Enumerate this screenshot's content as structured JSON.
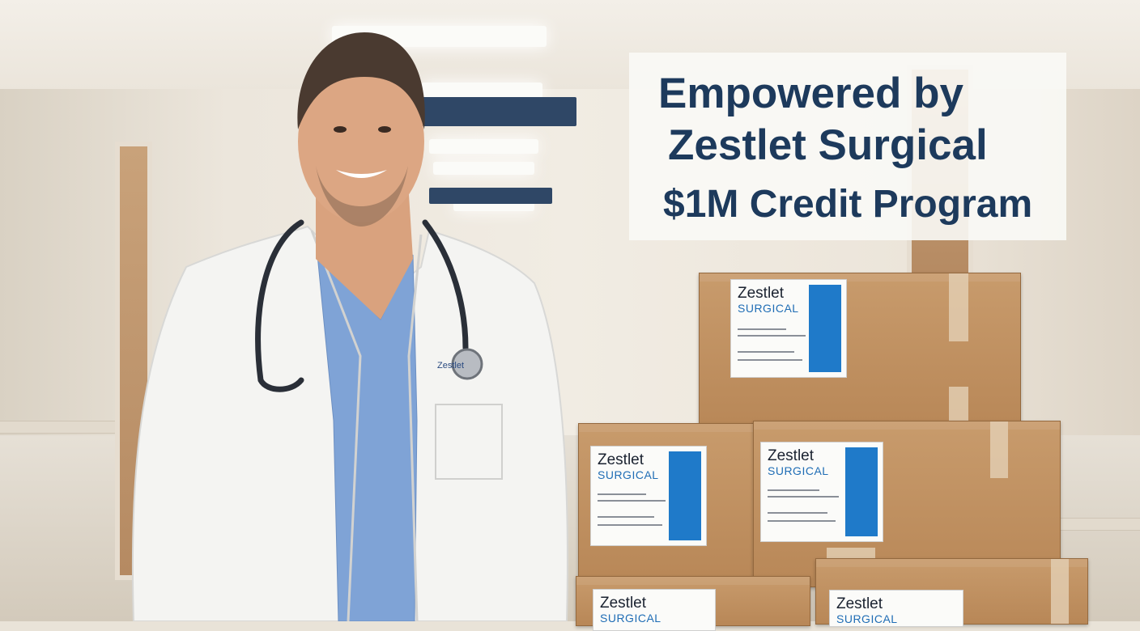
{
  "headline": {
    "line1": "Empowered by",
    "line2": "Zestlet Surgical",
    "line3": "$1M Credit Program"
  },
  "box_label": {
    "brand": "Zestlet",
    "trademark": "™",
    "sub": "SURGICAL"
  },
  "colors": {
    "headline_text": "#1d3a5c",
    "headline_panel": "#faf9f6",
    "label_accent": "#1f7ac9",
    "box": "#c89b6c",
    "scrubs": "#7fa3d6",
    "coat": "#f4f4f2"
  }
}
